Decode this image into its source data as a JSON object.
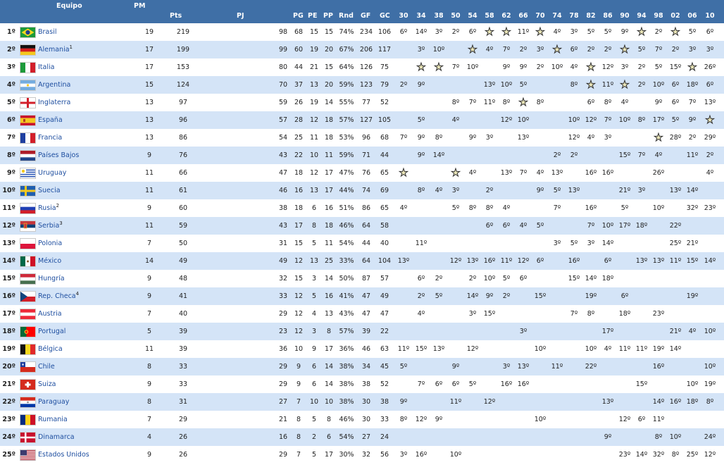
{
  "header": {
    "equipo": "Equipo",
    "pm": "PM",
    "pts": "Pts",
    "pj": "PJ",
    "pg": "PG",
    "pe": "PE",
    "pp": "PP",
    "rnd": "Rnd",
    "gf": "GF",
    "gc": "GC",
    "years": [
      "30",
      "34",
      "38",
      "50",
      "54",
      "58",
      "62",
      "66",
      "70",
      "74",
      "78",
      "82",
      "86",
      "90",
      "94",
      "98",
      "02",
      "06",
      "10"
    ]
  },
  "star_glyph": "★",
  "rows": [
    {
      "rank": "1º",
      "name": "Brasil",
      "sup": "",
      "flag": "br",
      "pm": "19",
      "pts": "219",
      "pj": "98",
      "pg": "68",
      "pe": "15",
      "pp": "15",
      "rnd": "74%",
      "gf": "234",
      "gc": "106",
      "part": [
        "6º",
        "14º",
        "3º",
        "2º",
        "6º",
        "*",
        "*",
        "11º",
        "*",
        "4º",
        "3º",
        "5º",
        "5º",
        "9º",
        "*",
        "2º",
        "*",
        "5º",
        "6º"
      ]
    },
    {
      "rank": "2º",
      "name": "Alemania",
      "sup": "1",
      "flag": "de",
      "pm": "17",
      "pts": "199",
      "pj": "99",
      "pg": "60",
      "pe": "19",
      "pp": "20",
      "rnd": "67%",
      "gf": "206",
      "gc": "117",
      "part": [
        "",
        "3º",
        "10º",
        "",
        "*",
        "4º",
        "7º",
        "2º",
        "3º",
        "*",
        "6º",
        "2º",
        "2º",
        "*",
        "5º",
        "7º",
        "2º",
        "3º",
        "3º"
      ]
    },
    {
      "rank": "3º",
      "name": "Italia",
      "sup": "",
      "flag": "it",
      "pm": "17",
      "pts": "153",
      "pj": "80",
      "pg": "44",
      "pe": "21",
      "pp": "15",
      "rnd": "64%",
      "gf": "126",
      "gc": "75",
      "part": [
        "",
        "*",
        "*",
        "7º",
        "10º",
        "",
        "9º",
        "9º",
        "2º",
        "10º",
        "4º",
        "*",
        "12º",
        "3º",
        "2º",
        "5º",
        "15º",
        "*",
        "26º"
      ]
    },
    {
      "rank": "4º",
      "name": "Argentina",
      "sup": "",
      "flag": "ar",
      "pm": "15",
      "pts": "124",
      "pj": "70",
      "pg": "37",
      "pe": "13",
      "pp": "20",
      "rnd": "59%",
      "gf": "123",
      "gc": "79",
      "part": [
        "2º",
        "9º",
        "",
        "",
        "",
        "13º",
        "10º",
        "5º",
        "",
        "",
        "8º",
        "*",
        "11º",
        "*",
        "2º",
        "10º",
        "6º",
        "18º",
        "6º",
        "5º"
      ]
    },
    {
      "rank": "5º",
      "name": "Inglaterra",
      "sup": "",
      "flag": "en",
      "pm": "13",
      "pts": "97",
      "pj": "59",
      "pg": "26",
      "pe": "19",
      "pp": "14",
      "rnd": "55%",
      "gf": "77",
      "gc": "52",
      "part": [
        "",
        "",
        "",
        "8º",
        "7º",
        "11º",
        "8º",
        "*",
        "8º",
        "",
        "",
        "6º",
        "8º",
        "4º",
        "",
        "9º",
        "6º",
        "7º",
        "13º"
      ]
    },
    {
      "rank": "6º",
      "name": "España",
      "sup": "",
      "flag": "es",
      "pm": "13",
      "pts": "96",
      "pj": "57",
      "pg": "28",
      "pe": "12",
      "pp": "18",
      "rnd": "57%",
      "gf": "127",
      "gc": "105",
      "part": [
        "",
        "5º",
        "",
        "4º",
        "",
        "",
        "12º",
        "10º",
        "",
        "",
        "10º",
        "12º",
        "7º",
        "10º",
        "8º",
        "17º",
        "5º",
        "9º",
        "*"
      ]
    },
    {
      "rank": "7º",
      "name": "Francia",
      "sup": "",
      "flag": "fr",
      "pm": "13",
      "pts": "86",
      "pj": "54",
      "pg": "25",
      "pe": "11",
      "pp": "18",
      "rnd": "53%",
      "gf": "96",
      "gc": "68",
      "part": [
        "7º",
        "9º",
        "8º",
        "",
        "9º",
        "3º",
        "",
        "13º",
        "",
        "",
        "12º",
        "4º",
        "3º",
        "",
        "",
        "*",
        "28º",
        "2º",
        "29º"
      ]
    },
    {
      "rank": "8º",
      "name": "Países Bajos",
      "sup": "",
      "flag": "nl",
      "pm": "9",
      "pts": "76",
      "pj": "43",
      "pg": "22",
      "pe": "10",
      "pp": "11",
      "rnd": "59%",
      "gf": "71",
      "gc": "44",
      "part": [
        "",
        "9º",
        "14º",
        "",
        "",
        "",
        "",
        "",
        "",
        "2º",
        "2º",
        "",
        "",
        "15º",
        "7º",
        "4º",
        "",
        "11º",
        "2º"
      ]
    },
    {
      "rank": "9º",
      "name": "Uruguay",
      "sup": "",
      "flag": "uy",
      "pm": "11",
      "pts": "66",
      "pj": "47",
      "pg": "18",
      "pe": "12",
      "pp": "17",
      "rnd": "47%",
      "gf": "76",
      "gc": "65",
      "part": [
        "*",
        "",
        "",
        "*",
        "4º",
        "",
        "13º",
        "7º",
        "4º",
        "13º",
        "",
        "16º",
        "16º",
        "",
        "",
        "26º",
        "",
        "",
        "4º"
      ]
    },
    {
      "rank": "10º",
      "name": "Suecia",
      "sup": "",
      "flag": "se",
      "pm": "11",
      "pts": "61",
      "pj": "46",
      "pg": "16",
      "pe": "13",
      "pp": "17",
      "rnd": "44%",
      "gf": "74",
      "gc": "69",
      "part": [
        "",
        "8º",
        "4º",
        "3º",
        "",
        "2º",
        "",
        "",
        "9º",
        "5º",
        "13º",
        "",
        "",
        "21º",
        "3º",
        "",
        "13º",
        "14º",
        ""
      ]
    },
    {
      "rank": "11º",
      "name": "Rusia",
      "sup": "2",
      "flag": "ru",
      "pm": "9",
      "pts": "60",
      "pj": "38",
      "pg": "18",
      "pe": "6",
      "pp": "16",
      "rnd": "51%",
      "gf": "86",
      "gc": "65",
      "part": [
        "4º",
        "",
        "",
        "5º",
        "8º",
        "8º",
        "4º",
        "",
        "",
        "7º",
        "",
        "16º",
        "",
        "5º",
        "",
        "10º",
        "",
        "32º",
        "23º"
      ]
    },
    {
      "rank": "12º",
      "name": "Serbia",
      "sup": "3",
      "flag": "rs",
      "pm": "11",
      "pts": "59",
      "pj": "43",
      "pg": "17",
      "pe": "8",
      "pp": "18",
      "rnd": "46%",
      "gf": "64",
      "gc": "58",
      "part": [
        "",
        "",
        "",
        "",
        "",
        "6º",
        "6º",
        "4º",
        "5º",
        "",
        "",
        "7º",
        "10º",
        "17º",
        "18º",
        "",
        "22º",
        "",
        ""
      ]
    },
    {
      "rank": "13º",
      "name": "Polonia",
      "sup": "",
      "flag": "pl",
      "pm": "7",
      "pts": "50",
      "pj": "31",
      "pg": "15",
      "pe": "5",
      "pp": "11",
      "rnd": "54%",
      "gf": "44",
      "gc": "40",
      "part": [
        "",
        "11º",
        "",
        "",
        "",
        "",
        "",
        "",
        "",
        "3º",
        "5º",
        "3º",
        "14º",
        "",
        "",
        "",
        "25º",
        "21º",
        ""
      ]
    },
    {
      "rank": "14º",
      "name": "México",
      "sup": "",
      "flag": "mx",
      "pm": "14",
      "pts": "49",
      "pj": "49",
      "pg": "12",
      "pe": "13",
      "pp": "25",
      "rnd": "33%",
      "gf": "64",
      "gc": "104",
      "part": [
        "13º",
        "",
        "",
        "12º",
        "13º",
        "16º",
        "11º",
        "12º",
        "6º",
        "",
        "16º",
        "",
        "6º",
        "",
        "13º",
        "13º",
        "11º",
        "15º",
        "14º"
      ]
    },
    {
      "rank": "15º",
      "name": "Hungría",
      "sup": "",
      "flag": "hu",
      "pm": "9",
      "pts": "48",
      "pj": "32",
      "pg": "15",
      "pe": "3",
      "pp": "14",
      "rnd": "50%",
      "gf": "87",
      "gc": "57",
      "part": [
        "",
        "6º",
        "2º",
        "",
        "2º",
        "10º",
        "5º",
        "6º",
        "",
        "",
        "15º",
        "14º",
        "18º",
        "",
        "",
        "",
        "",
        "",
        ""
      ]
    },
    {
      "rank": "16º",
      "name": "Rep. Checa",
      "sup": "4",
      "flag": "cz",
      "pm": "9",
      "pts": "41",
      "pj": "33",
      "pg": "12",
      "pe": "5",
      "pp": "16",
      "rnd": "41%",
      "gf": "47",
      "gc": "49",
      "part": [
        "",
        "2º",
        "5º",
        "",
        "14º",
        "9º",
        "2º",
        "",
        "15º",
        "",
        "",
        "19º",
        "",
        "6º",
        "",
        "",
        "",
        "19º",
        ""
      ]
    },
    {
      "rank": "17º",
      "name": "Austria",
      "sup": "",
      "flag": "at",
      "pm": "7",
      "pts": "40",
      "pj": "29",
      "pg": "12",
      "pe": "4",
      "pp": "13",
      "rnd": "43%",
      "gf": "47",
      "gc": "47",
      "part": [
        "",
        "4º",
        "",
        "",
        "3º",
        "15º",
        "",
        "",
        "",
        "",
        "7º",
        "8º",
        "",
        "18º",
        "",
        "23º",
        "",
        "",
        ""
      ]
    },
    {
      "rank": "18º",
      "name": "Portugal",
      "sup": "",
      "flag": "pt",
      "pm": "5",
      "pts": "39",
      "pj": "23",
      "pg": "12",
      "pe": "3",
      "pp": "8",
      "rnd": "57%",
      "gf": "39",
      "gc": "22",
      "part": [
        "",
        "",
        "",
        "",
        "",
        "",
        "",
        "3º",
        "",
        "",
        "",
        "",
        "17º",
        "",
        "",
        "",
        "21º",
        "4º",
        "10º"
      ]
    },
    {
      "rank": "19º",
      "name": "Bélgica",
      "sup": "",
      "flag": "be",
      "pm": "11",
      "pts": "39",
      "pj": "36",
      "pg": "10",
      "pe": "9",
      "pp": "17",
      "rnd": "36%",
      "gf": "46",
      "gc": "63",
      "part": [
        "11º",
        "15º",
        "13º",
        "",
        "12º",
        "",
        "",
        "",
        "10º",
        "",
        "",
        "10º",
        "4º",
        "11º",
        "11º",
        "19º",
        "14º",
        "",
        ""
      ]
    },
    {
      "rank": "20º",
      "name": "Chile",
      "sup": "",
      "flag": "cl",
      "pm": "8",
      "pts": "33",
      "pj": "29",
      "pg": "9",
      "pe": "6",
      "pp": "14",
      "rnd": "38%",
      "gf": "34",
      "gc": "45",
      "part": [
        "5º",
        "",
        "",
        "9º",
        "",
        "",
        "3º",
        "13º",
        "",
        "11º",
        "",
        "22º",
        "",
        "",
        "",
        "16º",
        "",
        "",
        "10º"
      ]
    },
    {
      "rank": "21º",
      "name": "Suiza",
      "sup": "",
      "flag": "ch",
      "pm": "9",
      "pts": "33",
      "pj": "29",
      "pg": "9",
      "pe": "6",
      "pp": "14",
      "rnd": "38%",
      "gf": "38",
      "gc": "52",
      "part": [
        "",
        "7º",
        "6º",
        "6º",
        "5º",
        "",
        "16º",
        "16º",
        "",
        "",
        "",
        "",
        "",
        "",
        "15º",
        "",
        "",
        "10º",
        "19º"
      ]
    },
    {
      "rank": "22º",
      "name": "Paraguay",
      "sup": "",
      "flag": "py",
      "pm": "8",
      "pts": "31",
      "pj": "27",
      "pg": "7",
      "pe": "10",
      "pp": "10",
      "rnd": "38%",
      "gf": "30",
      "gc": "38",
      "part": [
        "9º",
        "",
        "",
        "11º",
        "",
        "12º",
        "",
        "",
        "",
        "",
        "",
        "",
        "13º",
        "",
        "",
        "14º",
        "16º",
        "18º",
        "8º"
      ]
    },
    {
      "rank": "23º",
      "name": "Rumania",
      "sup": "",
      "flag": "ro",
      "pm": "7",
      "pts": "29",
      "pj": "21",
      "pg": "8",
      "pe": "5",
      "pp": "8",
      "rnd": "46%",
      "gf": "30",
      "gc": "33",
      "part": [
        "8º",
        "12º",
        "9º",
        "",
        "",
        "",
        "",
        "",
        "10º",
        "",
        "",
        "",
        "",
        "12º",
        "6º",
        "11º",
        "",
        "",
        ""
      ]
    },
    {
      "rank": "24º",
      "name": "Dinamarca",
      "sup": "",
      "flag": "dk",
      "pm": "4",
      "pts": "26",
      "pj": "16",
      "pg": "8",
      "pe": "2",
      "pp": "6",
      "rnd": "54%",
      "gf": "27",
      "gc": "24",
      "part": [
        "",
        "",
        "",
        "",
        "",
        "",
        "",
        "",
        "",
        "",
        "",
        "",
        "9º",
        "",
        "",
        "8º",
        "10º",
        "",
        "24º"
      ]
    },
    {
      "rank": "25º",
      "name": "Estados Unidos",
      "sup": "",
      "flag": "us",
      "pm": "9",
      "pts": "26",
      "pj": "29",
      "pg": "7",
      "pe": "5",
      "pp": "17",
      "rnd": "30%",
      "gf": "32",
      "gc": "56",
      "part": [
        "3º",
        "16º",
        "",
        "10º",
        "",
        "",
        "",
        "",
        "",
        "",
        "",
        "",
        "",
        "23º",
        "14º",
        "32º",
        "8º",
        "25º",
        "12º"
      ]
    }
  ]
}
